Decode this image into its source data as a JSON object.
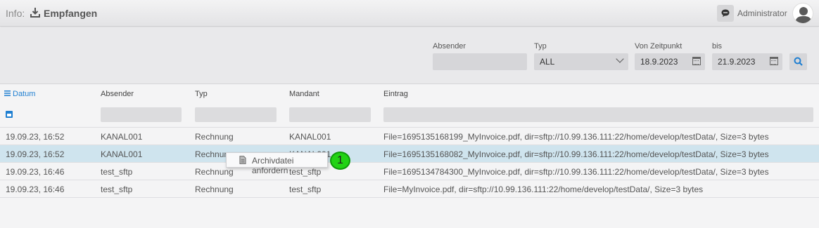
{
  "header": {
    "info_label": "Info:",
    "title": "Empfangen",
    "user": "Administrator"
  },
  "filters": {
    "sender": {
      "label": "Absender",
      "value": ""
    },
    "type": {
      "label": "Typ",
      "value": "ALL"
    },
    "from": {
      "label": "Von Zeitpunkt",
      "value": "18.9.2023"
    },
    "to": {
      "label": "bis",
      "value": "21.9.2023"
    }
  },
  "table": {
    "columns": [
      "Datum",
      "Absender",
      "Typ",
      "Mandant",
      "Eintrag"
    ],
    "rows": [
      [
        "19.09.23, 16:52",
        "KANAL001",
        "Rechnung",
        "KANAL001",
        "File=1695135168199_MyInvoice.pdf, dir=sftp://10.99.136.111:22/home/develop/testData/, Size=3 bytes"
      ],
      [
        "19.09.23, 16:52",
        "KANAL001",
        "Rechnung",
        "KANAL001",
        "File=1695135168082_MyInvoice.pdf, dir=sftp://10.99.136.111:22/home/develop/testData/, Size=3 bytes"
      ],
      [
        "19.09.23, 16:46",
        "test_sftp",
        "Rechnung",
        "test_sftp",
        "File=1695134784300_MyInvoice.pdf, dir=sftp://10.99.136.111:22/home/develop/testData/, Size=3 bytes"
      ],
      [
        "19.09.23, 16:46",
        "test_sftp",
        "Rechnung",
        "test_sftp",
        "File=MyInvoice.pdf, dir=sftp://10.99.136.111:22/home/develop/testData/, Size=3 bytes"
      ]
    ]
  },
  "context_menu": {
    "item_label": "Archivdatei anfordern"
  },
  "callout": {
    "number": "1"
  },
  "colors": {
    "accent": "#1f7fd1",
    "selected_row": "#cfe4ee",
    "callout": "#22d315"
  }
}
